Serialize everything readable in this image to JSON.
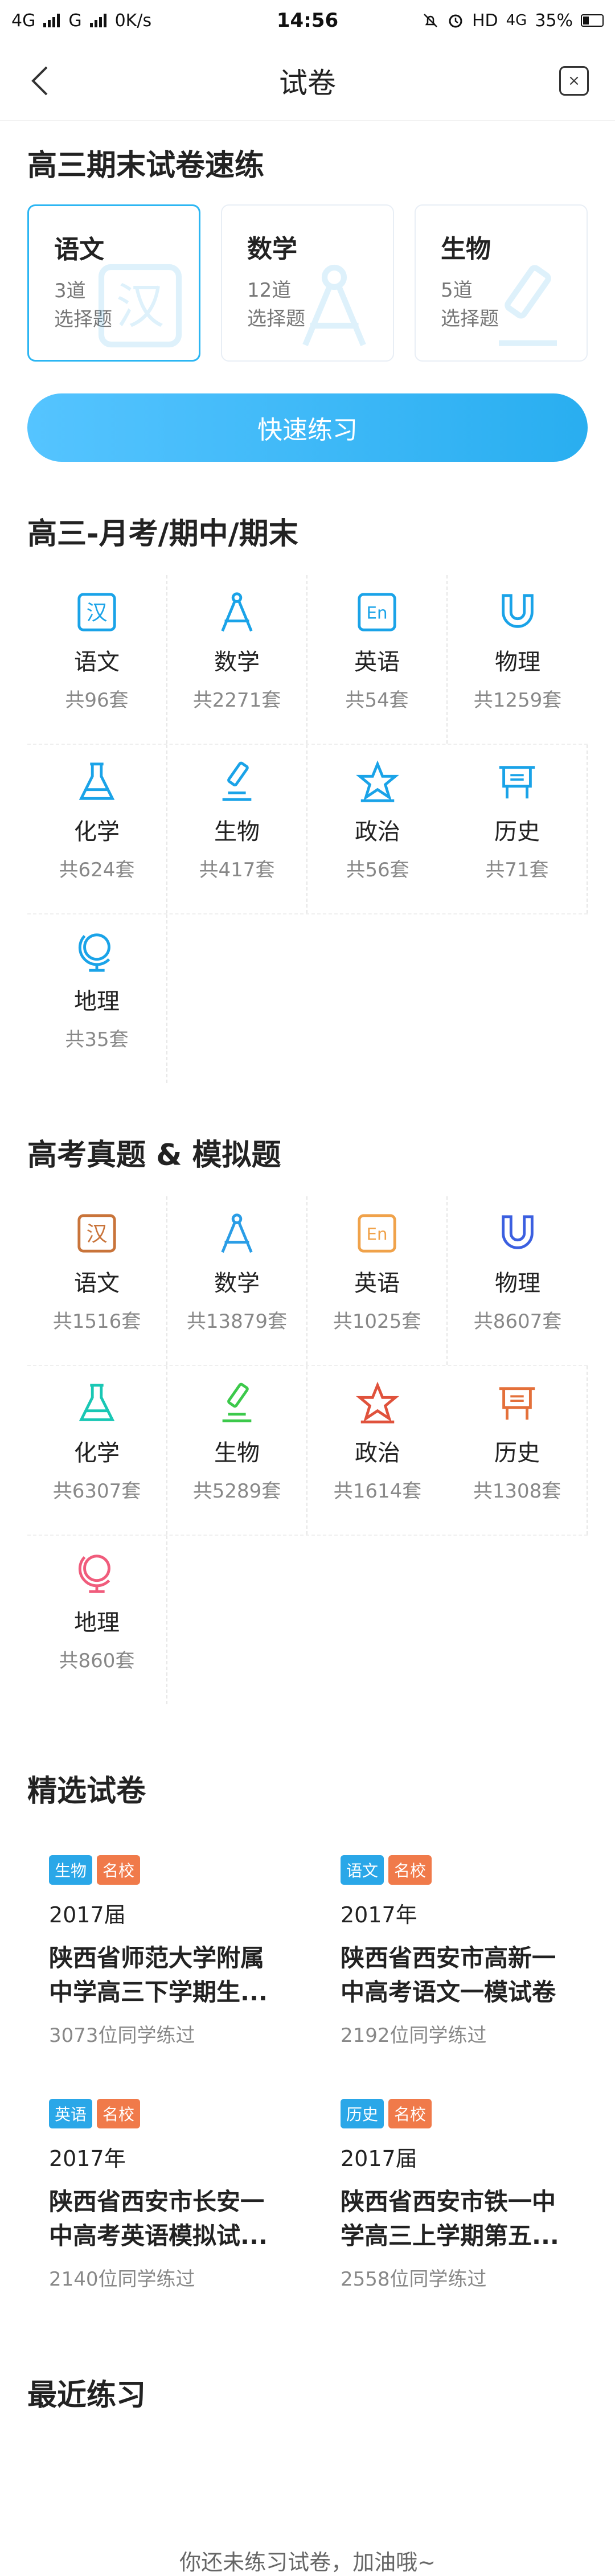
{
  "statusbar": {
    "network": "4G",
    "carrier": "G",
    "speed": "0K/s",
    "time": "14:56",
    "hd": "HD",
    "lte": "4G",
    "battery": "35%"
  },
  "navbar": {
    "title": "试卷"
  },
  "quick": {
    "title": "高三期末试卷速练",
    "cards": [
      {
        "subject": "语文",
        "count": "3道",
        "type": "选择题",
        "bg_icon": "han-icon"
      },
      {
        "subject": "数学",
        "count": "12道",
        "type": "选择题",
        "bg_icon": "compass-icon"
      },
      {
        "subject": "生物",
        "count": "5道",
        "type": "选择题",
        "bg_icon": "microscope-icon"
      }
    ],
    "button_label": "快速练习"
  },
  "monthly": {
    "title": "高三-月考/期中/期末",
    "color": "#1aa3e8",
    "items": [
      {
        "name": "语文",
        "count": "共96套",
        "icon": "han-icon"
      },
      {
        "name": "数学",
        "count": "共2271套",
        "icon": "compass-icon"
      },
      {
        "name": "英语",
        "count": "共54套",
        "icon": "en-icon"
      },
      {
        "name": "物理",
        "count": "共1259套",
        "icon": "magnet-icon"
      },
      {
        "name": "化学",
        "count": "共624套",
        "icon": "flask-icon"
      },
      {
        "name": "生物",
        "count": "共417套",
        "icon": "microscope-icon"
      },
      {
        "name": "政治",
        "count": "共56套",
        "icon": "star-icon"
      },
      {
        "name": "历史",
        "count": "共71套",
        "icon": "bronze-vessel-icon"
      },
      {
        "name": "地理",
        "count": "共35套",
        "icon": "globe-icon"
      }
    ]
  },
  "gaokao": {
    "title": "高考真题 & 模拟题",
    "items": [
      {
        "name": "语文",
        "count": "共1516套",
        "icon": "han-icon",
        "color": "#c9743a"
      },
      {
        "name": "数学",
        "count": "共13879套",
        "icon": "compass-icon",
        "color": "#2a9de6"
      },
      {
        "name": "英语",
        "count": "共1025套",
        "icon": "en-icon",
        "color": "#f0a24a"
      },
      {
        "name": "物理",
        "count": "共8607套",
        "icon": "magnet-icon",
        "color": "#3b5fe0"
      },
      {
        "name": "化学",
        "count": "共6307套",
        "icon": "flask-icon",
        "color": "#19c7b4"
      },
      {
        "name": "生物",
        "count": "共5289套",
        "icon": "microscope-icon",
        "color": "#3cc94b"
      },
      {
        "name": "政治",
        "count": "共1614套",
        "icon": "star-icon",
        "color": "#e0523c"
      },
      {
        "name": "历史",
        "count": "共1308套",
        "icon": "bronze-vessel-icon",
        "color": "#e4703a"
      },
      {
        "name": "地理",
        "count": "共860套",
        "icon": "globe-icon",
        "color": "#f05c7c"
      }
    ]
  },
  "papers": {
    "title": "精选试卷",
    "items": [
      {
        "tags": [
          {
            "label": "生物",
            "color": "#2aa7e8"
          },
          {
            "label": "名校",
            "color": "#f07a4a"
          }
        ],
        "year": "2017届",
        "title_line1": "陕西省师范大学附属",
        "title_line2": "中学高三下学期生...",
        "count": "3073位同学练过"
      },
      {
        "tags": [
          {
            "label": "语文",
            "color": "#2aa7e8"
          },
          {
            "label": "名校",
            "color": "#f07a4a"
          }
        ],
        "year": "2017年",
        "title_line1": "陕西省西安市高新一",
        "title_line2": "中高考语文一模试卷",
        "count": "2192位同学练过"
      },
      {
        "tags": [
          {
            "label": "英语",
            "color": "#2aa7e8"
          },
          {
            "label": "名校",
            "color": "#f07a4a"
          }
        ],
        "year": "2017年",
        "title_line1": "陕西省西安市长安一",
        "title_line2": "中高考英语模拟试...",
        "count": "2140位同学练过"
      },
      {
        "tags": [
          {
            "label": "历史",
            "color": "#2aa7e8"
          },
          {
            "label": "名校",
            "color": "#f07a4a"
          }
        ],
        "year": "2017届",
        "title_line1": "陕西省西安市铁一中",
        "title_line2": "学高三上学期第五...",
        "count": "2558位同学练过"
      }
    ]
  },
  "recent": {
    "title": "最近练习",
    "empty_text": "你还未练习试卷，加油哦~"
  }
}
